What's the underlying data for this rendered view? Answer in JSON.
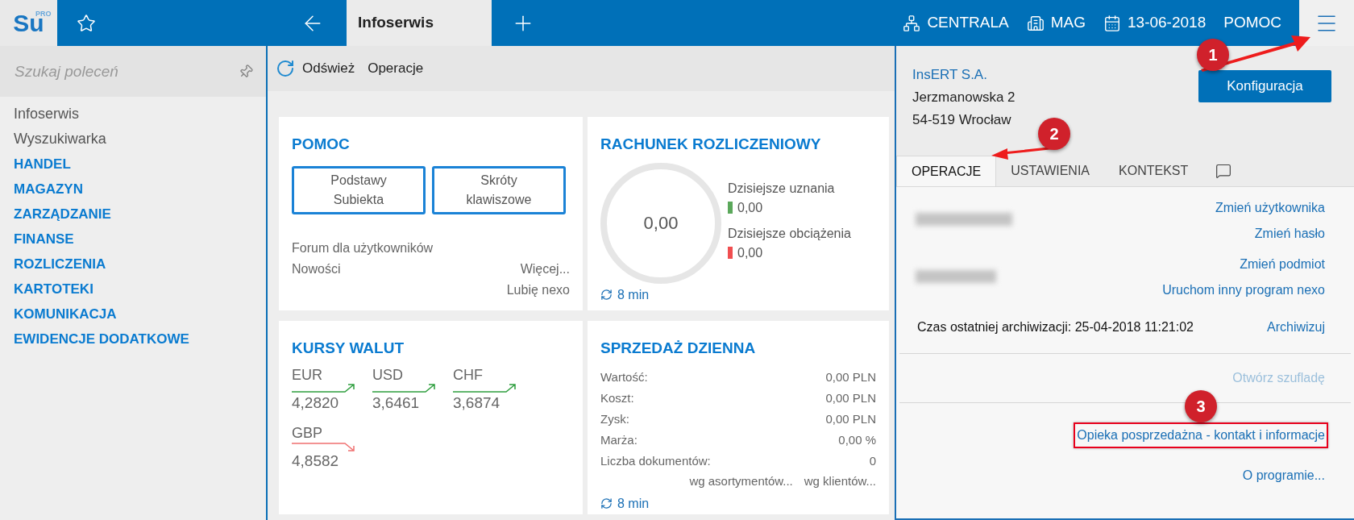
{
  "logo": {
    "text": "Su",
    "badge": "PRO"
  },
  "top_bar": {
    "tab": "Infoserwis",
    "items": [
      {
        "kind": "branch",
        "label": "CENTRALA"
      },
      {
        "kind": "warehouse",
        "label": "MAG"
      },
      {
        "kind": "date",
        "label": "13-06-2018"
      },
      {
        "kind": "plain",
        "label": "POMOC"
      }
    ]
  },
  "sidebar": {
    "search": {
      "placeholder": "Szukaj poleceń"
    },
    "items": [
      {
        "label": "Infoserwis",
        "kind": "plain"
      },
      {
        "label": "Wyszukiwarka",
        "kind": "plain"
      },
      {
        "label": "HANDEL",
        "kind": "module"
      },
      {
        "label": "MAGAZYN",
        "kind": "module"
      },
      {
        "label": "ZARZĄDZANIE",
        "kind": "module"
      },
      {
        "label": "FINANSE",
        "kind": "module"
      },
      {
        "label": "ROZLICZENIA",
        "kind": "module"
      },
      {
        "label": "KARTOTEKI",
        "kind": "module"
      },
      {
        "label": "KOMUNIKACJA",
        "kind": "module"
      },
      {
        "label": "EWIDENCJE DODATKOWE",
        "kind": "module"
      }
    ]
  },
  "toolbar": {
    "refresh": "Odśwież",
    "operations": "Operacje"
  },
  "tiles": {
    "help": {
      "title": "POMOC",
      "buttons": [
        "Podstawy Subiekta",
        "Skróty klawiszowe"
      ],
      "forum": "Forum dla użytkowników",
      "news": "Nowości",
      "more": "Więcej...",
      "like": "Lubię nexo"
    },
    "account": {
      "title": "RACHUNEK ROZLICZENIOWY",
      "balance": "0,00",
      "legend": [
        {
          "label": "Dzisiejsze uznania",
          "value": "0,00",
          "color": "#5ba85b"
        },
        {
          "label": "Dzisiejsze obciążenia",
          "value": "0,00",
          "color": "#f04e50"
        }
      ],
      "refresh": "8 min"
    },
    "rates": {
      "title": "KURSY WALUT",
      "currencies": [
        {
          "code": "EUR",
          "rate": "4,2820",
          "rising": true
        },
        {
          "code": "USD",
          "rate": "3,6461",
          "rising": true
        },
        {
          "code": "CHF",
          "rate": "3,6874",
          "rising": true
        },
        {
          "code": "GBP",
          "rate": "4,8582",
          "rising": false
        }
      ]
    },
    "sales": {
      "title": "SPRZEDAŻ DZIENNA",
      "rows": [
        {
          "label": "Wartość:",
          "value": "0,00 PLN"
        },
        {
          "label": "Koszt:",
          "value": "0,00 PLN"
        },
        {
          "label": "Zysk:",
          "value": "0,00 PLN"
        },
        {
          "label": "Marża:",
          "value": "0,00 %"
        },
        {
          "label": "Liczba dokumentów:",
          "value": "0"
        }
      ],
      "links": [
        "wg asortymentów...",
        "wg klientów..."
      ],
      "refresh": "8 min"
    }
  },
  "panel": {
    "company": {
      "name": "InsERT S.A.",
      "street": "Jerzmanowska 2",
      "city": "54-519 Wrocław"
    },
    "config_button": "Konfiguracja",
    "tabs": [
      {
        "kind": "text",
        "label": "OPERACJE",
        "selected": true
      },
      {
        "kind": "text",
        "label": "USTAWIENIA",
        "selected": false
      },
      {
        "kind": "text",
        "label": "KONTEKST",
        "selected": false
      },
      {
        "kind": "chat",
        "selected": false
      }
    ],
    "user_links": [
      "Zmień użytkownika",
      "Zmień hasło"
    ],
    "entity_links": [
      "Zmień podmiot",
      "Uruchom inny program nexo"
    ],
    "archive": {
      "text": "Czas ostatniej archiwizacji: 25-04-2018 11:21:02",
      "action": "Archiwizuj"
    },
    "drawer": {
      "label": "Otwórz szufladę",
      "disabled": true
    },
    "support": {
      "label": "Opieka posprzedażna - kontakt i informacje",
      "highlighted": true
    },
    "about": "O programie..."
  },
  "annotations": [
    {
      "label": "1"
    },
    {
      "label": "2"
    },
    {
      "label": "3"
    }
  ]
}
